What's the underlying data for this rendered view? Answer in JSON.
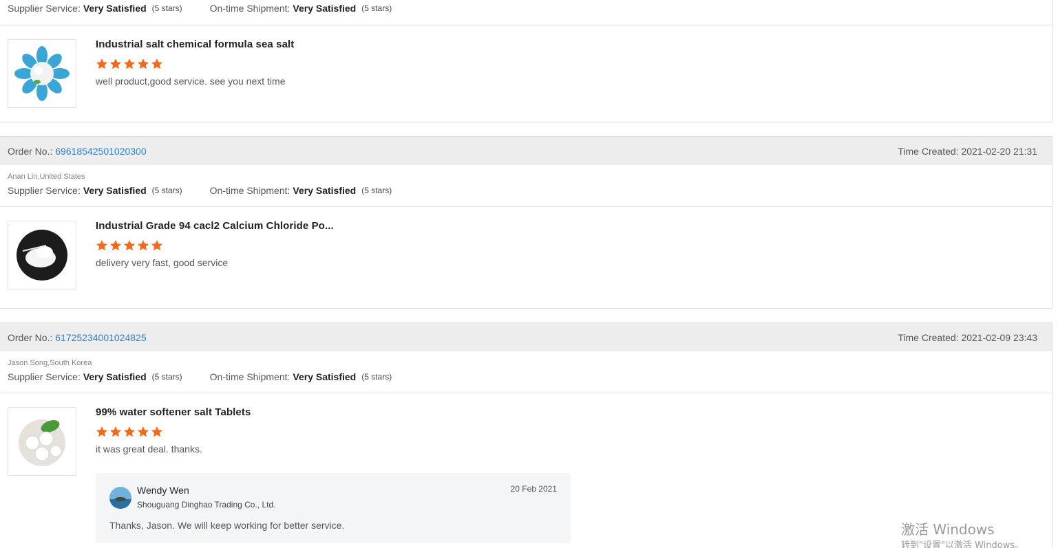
{
  "labels": {
    "order_no": "Order No.: ",
    "time_created": "Time Created: ",
    "supplier_service": "Supplier Service:",
    "ontime_shipment": "On-time Shipment:"
  },
  "top_partial": {
    "supplier_service_value": "Very Satisfied",
    "supplier_service_stars": "(5 stars)",
    "ontime_shipment_value": "Very Satisfied",
    "ontime_shipment_stars": "(5 stars)",
    "product": {
      "name": "Industrial salt chemical formula sea salt",
      "rating": 5,
      "comment": "well product,good service. see you next time"
    }
  },
  "orders": [
    {
      "order_no": "69618542501020300",
      "time_created": "2021-02-20 21:31",
      "buyer": "Anan Lin,United States",
      "supplier_service_value": "Very Satisfied",
      "supplier_service_stars": "(5 stars)",
      "ontime_shipment_value": "Very Satisfied",
      "ontime_shipment_stars": "(5 stars)",
      "product": {
        "name": "Industrial Grade 94 cacl2 Calcium Chloride Po...",
        "rating": 5,
        "comment": "delivery very fast, good service"
      }
    },
    {
      "order_no": "61725234001024825",
      "time_created": "2021-02-09 23:43",
      "buyer": "Jason Song,South Korea",
      "supplier_service_value": "Very Satisfied",
      "supplier_service_stars": "(5 stars)",
      "ontime_shipment_value": "Very Satisfied",
      "ontime_shipment_stars": "(5 stars)",
      "product": {
        "name": "99% water softener salt Tablets",
        "rating": 5,
        "comment": "it was great deal. thanks."
      },
      "reply": {
        "name": "Wendy Wen",
        "company": "Shouguang Dinghao Trading Co., Ltd.",
        "date": "20 Feb 2021",
        "text": "Thanks,  Jason. We will keep working for better service."
      }
    }
  ],
  "watermark": {
    "line1": "激活 Windows",
    "line2": "转到\"设置\"以激活 Windows。"
  },
  "colors": {
    "star": "#f26a1b",
    "link": "#2f7fd1",
    "header_bg": "#ededed"
  }
}
